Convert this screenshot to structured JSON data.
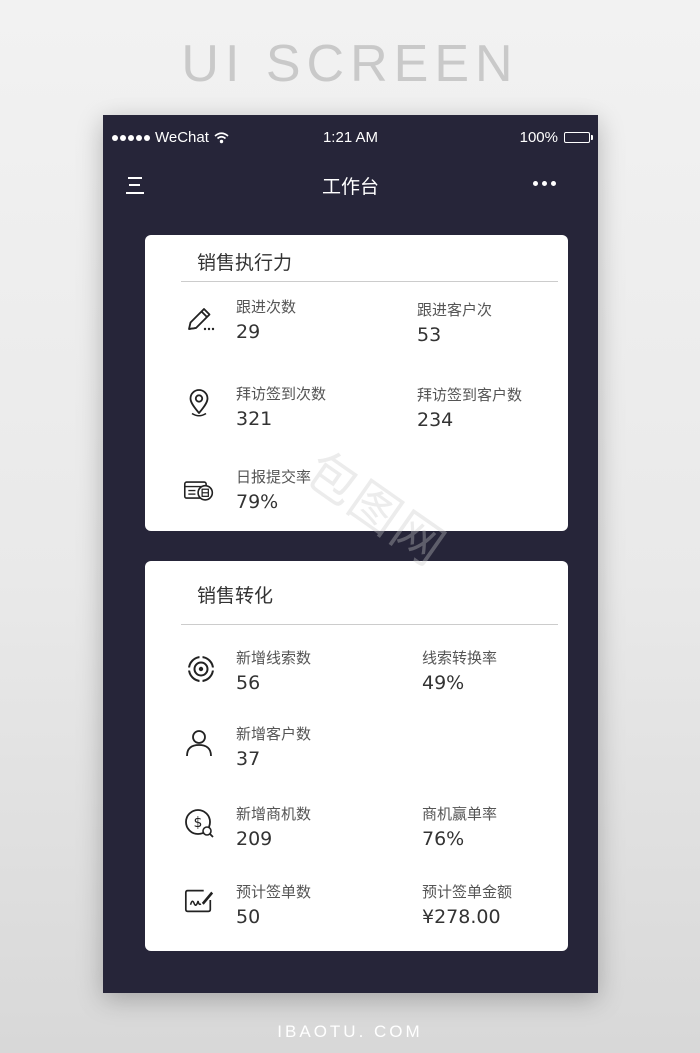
{
  "watermarks": {
    "header": "UI SCREEN",
    "footer": "IBAOTU. COM",
    "stamp": "包图网"
  },
  "statusbar": {
    "carrier": "WeChat",
    "time": "1:21 AM",
    "battery": "100%"
  },
  "navbar": {
    "title": "工作台",
    "menu_glyph": "三"
  },
  "execution": {
    "title": "销售执行力",
    "items": [
      {
        "label": "跟进次数",
        "value": "29",
        "icon": "edit-pencil-icon"
      },
      {
        "label": "跟进客户次",
        "value": "53",
        "icon": ""
      },
      {
        "label": "拜访签到次数",
        "value": "321",
        "icon": "location-pin-icon"
      },
      {
        "label": "拜访签到客户数",
        "value": "234",
        "icon": ""
      },
      {
        "label": "日报提交率",
        "value": "79%",
        "icon": "daily-report-icon"
      }
    ]
  },
  "conversion": {
    "title": "销售转化",
    "items": [
      {
        "label": "新增线索数",
        "value": "56",
        "icon": "target-icon"
      },
      {
        "label": "线索转换率",
        "value": "49%",
        "icon": ""
      },
      {
        "label": "新增客户数",
        "value": "37",
        "icon": "user-icon"
      },
      {
        "label": "新增商机数",
        "value": "209",
        "icon": "dollar-search-icon"
      },
      {
        "label": "商机赢单率",
        "value": "76%",
        "icon": ""
      },
      {
        "label": "预计签单数",
        "value": "50",
        "icon": "signature-icon"
      },
      {
        "label": "预计签单金额",
        "value": "¥278.00",
        "icon": ""
      }
    ]
  },
  "colors": {
    "phone_bg": "#262539",
    "card_bg": "#ffffff",
    "text_primary": "#333333",
    "text_secondary": "#555555"
  }
}
